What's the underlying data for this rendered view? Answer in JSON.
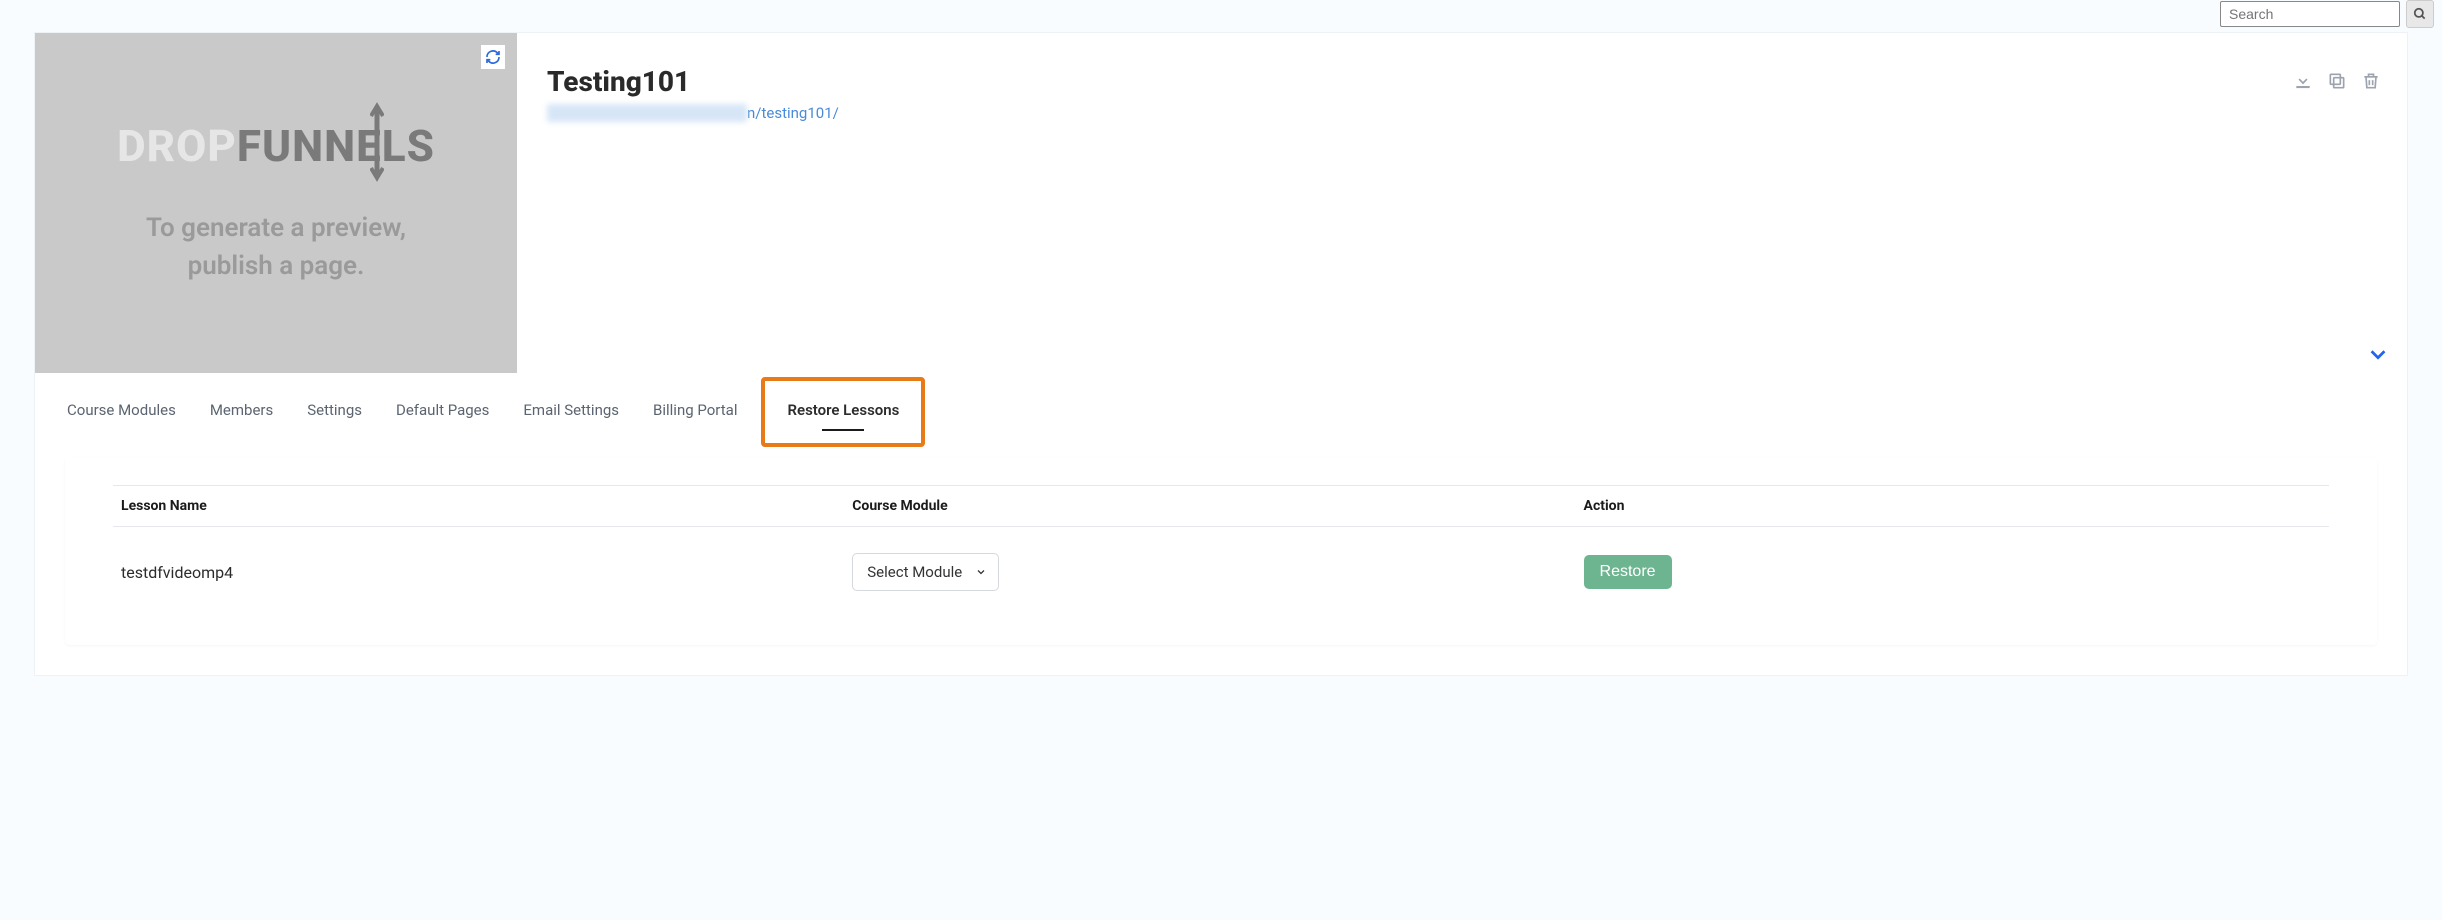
{
  "search": {
    "placeholder": "Search"
  },
  "preview": {
    "logo_left": "DROP",
    "logo_right": "FUNNELS",
    "message_line1": "To generate a preview,",
    "message_line2": "publish a page."
  },
  "course": {
    "title": "Testing101",
    "url_suffix": "n/testing101/"
  },
  "tabs": [
    {
      "label": "Course Modules",
      "active": false
    },
    {
      "label": "Members",
      "active": false
    },
    {
      "label": "Settings",
      "active": false
    },
    {
      "label": "Default Pages",
      "active": false
    },
    {
      "label": "Email Settings",
      "active": false
    },
    {
      "label": "Billing Portal",
      "active": false
    },
    {
      "label": "Restore Lessons",
      "active": true,
      "highlighted": true
    }
  ],
  "table": {
    "headers": {
      "name": "Lesson Name",
      "module": "Course Module",
      "action": "Action"
    },
    "rows": [
      {
        "name": "testdfvideomp4",
        "module_select": "Select Module",
        "action_label": "Restore"
      }
    ]
  }
}
